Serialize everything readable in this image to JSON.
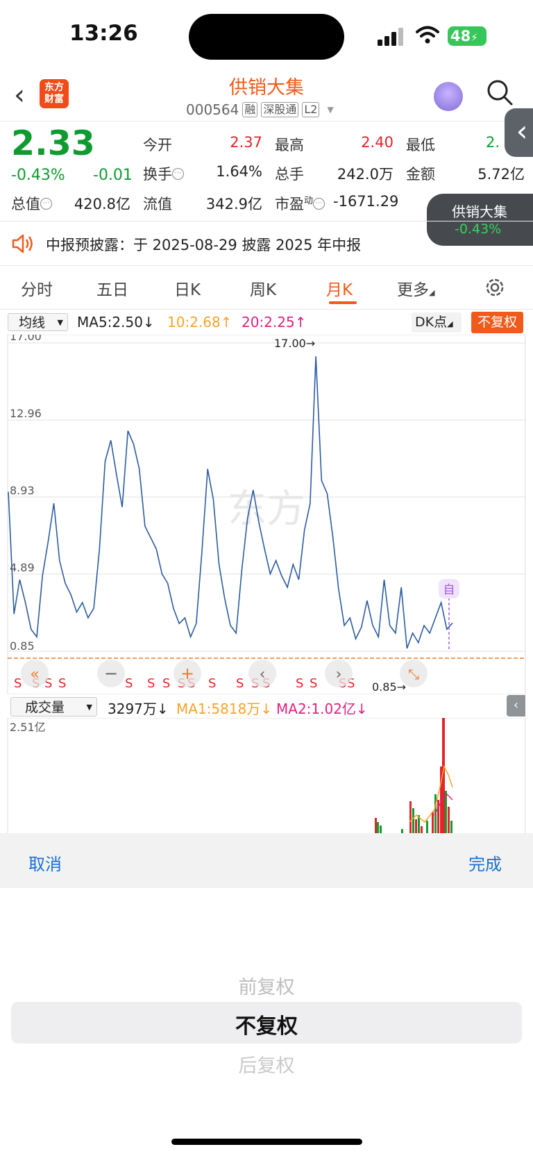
{
  "status_bar": {
    "time": "13:26",
    "battery": "48"
  },
  "header": {
    "logo_line1": "东方",
    "logo_line2": "财富",
    "stock_name": "供销大集",
    "stock_code": "000564",
    "tags": [
      "融",
      "深股通",
      "L2"
    ]
  },
  "quote": {
    "price": "2.33",
    "change_pct": "-0.43%",
    "change": "-0.01",
    "fields": {
      "open_label": "今开",
      "open_value": "2.37",
      "high_label": "最高",
      "high_value": "2.40",
      "low_label": "最低",
      "low_value": "2.",
      "turnover_label": "换手",
      "turnover_value": "1.64%",
      "volume_label": "总手",
      "volume_value": "242.0万",
      "amount_label": "金额",
      "amount_value": "5.72亿",
      "mktcap_label": "总值",
      "mktcap_value": "420.8亿",
      "float_label": "流值",
      "float_value": "342.9亿",
      "pe_label": "市盈",
      "pe_sup": "动",
      "pe_value": "-1671.29"
    }
  },
  "floating_card": {
    "name": "供销大集",
    "pct": "-0.43%"
  },
  "notice": {
    "text": "中报预披露：于 2025-08-29 披露 2025 年中报"
  },
  "tabs": [
    "分时",
    "五日",
    "日K",
    "周K",
    "月K",
    "更多"
  ],
  "active_tab": "月K",
  "ma_bar": {
    "select_label": "均线",
    "ma5": "MA5:2.50↓",
    "ma10": "10:2.68↑",
    "ma20": "20:2.25↑",
    "dk_label": "DK点",
    "fq_label": "不复权"
  },
  "kline": {
    "y_ticks": [
      "17.00",
      "12.96",
      "8.93",
      "4.89",
      "0.85"
    ],
    "max_annotation": "17.00→",
    "min_annotation": "0.85→",
    "s_marker": "S",
    "self_marker": "自"
  },
  "volume": {
    "select_label": "成交量",
    "value": "3297万↓",
    "ma1": "MA1:5818万↓",
    "ma2": "MA2:1.02亿↓",
    "y_top": "2.51亿"
  },
  "picker": {
    "cancel": "取消",
    "done": "完成",
    "options": [
      "前复权",
      "不复权",
      "后复权"
    ],
    "selected": "不复权"
  },
  "colors": {
    "brand": "#f05a1a",
    "up": "#e3242b",
    "down": "#0f9b2f",
    "line": "#2c5aa0"
  },
  "chart_data": {
    "type": "line",
    "title": "",
    "ylim": [
      0.85,
      17.0
    ],
    "y_ticks": [
      17.0,
      12.96,
      8.93,
      4.89,
      0.85
    ],
    "series": [
      {
        "values": [
          9.2,
          2.8,
          4.6,
          3.4,
          2.0,
          1.6,
          4.8,
          6.6,
          8.6,
          5.6,
          4.4,
          3.8,
          2.9,
          3.4,
          2.6,
          3.1,
          6.2,
          10.8,
          11.9,
          10.1,
          8.4,
          12.4,
          11.7,
          10.4,
          7.4,
          6.8,
          6.2,
          4.9,
          4.4,
          3.1,
          2.3,
          2.6,
          1.6,
          2.3,
          6.1,
          10.4,
          8.8,
          5.4,
          3.6,
          2.2,
          1.8,
          5.1,
          7.8,
          9.3,
          7.6,
          6.2,
          4.9,
          5.6,
          4.8,
          4.2,
          5.4,
          4.6,
          7.2,
          8.6,
          16.3,
          9.8,
          9.1,
          6.8,
          4.1,
          2.2,
          2.6,
          1.5,
          2.1,
          3.5,
          2.2,
          1.6,
          4.6,
          2.2,
          1.8,
          4.2,
          1.0,
          1.8,
          1.3,
          2.2,
          1.8,
          2.6,
          3.4,
          2.0,
          2.33
        ]
      }
    ]
  }
}
